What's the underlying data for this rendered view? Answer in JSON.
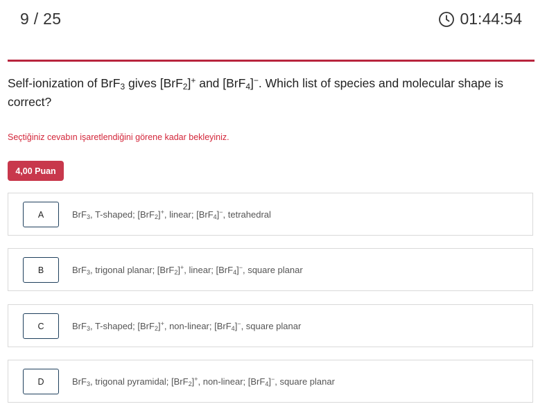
{
  "header": {
    "counter": "9 / 25",
    "timer": "01:44:54"
  },
  "question": {
    "p1": "Self-ionization of BrF",
    "s1": "3",
    "p2": " gives [BrF",
    "s2": "2",
    "p3": "]",
    "sup1": "+",
    "p4": " and [BrF",
    "s3": "4",
    "p5": "]",
    "sup2": "−",
    "p6": ". Which list of species and molecular shape is correct?"
  },
  "notice": "Seçtiğiniz cevabın işaretlendiğini görene kadar bekleyiniz.",
  "points": "4,00 Puan",
  "options": [
    {
      "letter": "A",
      "t1": "BrF",
      "s1": "3",
      "t2": ", T-shaped; [BrF",
      "s2": "2",
      "t3": "]",
      "sup1": "+",
      "t4": ", linear; [BrF",
      "s3": "4",
      "t5": "]",
      "sup2": "−",
      "t6": ", tetrahedral"
    },
    {
      "letter": "B",
      "t1": "BrF",
      "s1": "3",
      "t2": ", trigonal planar; [BrF",
      "s2": "2",
      "t3": "]",
      "sup1": "+",
      "t4": ", linear; [BrF",
      "s3": "4",
      "t5": "]",
      "sup2": "−",
      "t6": ", square planar"
    },
    {
      "letter": "C",
      "t1": "BrF",
      "s1": "3",
      "t2": ", T-shaped; [BrF",
      "s2": "2",
      "t3": "]",
      "sup1": "+",
      "t4": ", non-linear; [BrF",
      "s3": "4",
      "t5": "]",
      "sup2": "−",
      "t6": ", square planar"
    },
    {
      "letter": "D",
      "t1": "BrF",
      "s1": "3",
      "t2": ", trigonal pyramidal; [BrF",
      "s2": "2",
      "t3": "]",
      "sup1": "+",
      "t4": ", non-linear; [BrF",
      "s3": "4",
      "t5": "]",
      "sup2": "−",
      "t6": ", square planar"
    }
  ],
  "colors": {
    "accent": "#b8253d",
    "points_bg": "#c8384c",
    "notice": "#d3263a",
    "letter_border": "#1e3f5c"
  },
  "icons": {
    "timer": "clock-icon"
  }
}
